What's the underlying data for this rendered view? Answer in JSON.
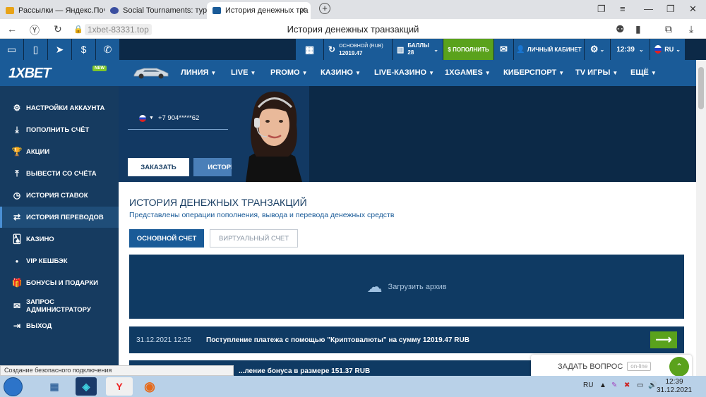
{
  "browser": {
    "tabs": [
      {
        "title": "Рассылки — Яндекс.Почта",
        "active": false
      },
      {
        "title": "Social Tournaments: турни",
        "active": false
      },
      {
        "title": "История денежных тра",
        "active": true
      }
    ],
    "url": "1xbet-83331.top",
    "page_title": "История денежных транзакций"
  },
  "topbar": {
    "balance_label": "ОСНОВНОЙ (RUB)",
    "balance_value": "12019.47",
    "points_label": "БАЛЛЫ",
    "points_value": "28",
    "deposit_label": "$ ПОПОЛНИТЬ",
    "cabinet_label": "ЛИЧНЫЙ КАБИНЕТ",
    "time": "12:39",
    "lang": "RU"
  },
  "nav": {
    "logo": "1XBET",
    "new_badge": "NEW",
    "items": [
      "ЛИНИЯ",
      "LIVE",
      "PROMO",
      "КАЗИНО",
      "LIVE-КАЗИНО",
      "1XGAMES",
      "КИБЕРСПОРТ",
      "TV ИГРЫ",
      "ЕЩЁ"
    ]
  },
  "sidebar": {
    "items": [
      {
        "label": "НАСТРОЙКИ АККАУНТА",
        "icon": "gears-icon"
      },
      {
        "label": "ПОПОЛНИТЬ СЧЁТ",
        "icon": "download-icon"
      },
      {
        "label": "АКЦИИ",
        "icon": "trophy-icon"
      },
      {
        "label": "ВЫВЕСТИ СО СЧЁТА",
        "icon": "upload-icon"
      },
      {
        "label": "ИСТОРИЯ СТАВОК",
        "icon": "clock-icon"
      },
      {
        "label": "ИСТОРИЯ ПЕРЕВОДОВ",
        "icon": "transfer-icon"
      },
      {
        "label": "КАЗИНО",
        "icon": "cards-icon"
      },
      {
        "label": "VIP КЕШБЭК",
        "icon": "dot-icon"
      },
      {
        "label": "БОНУСЫ И ПОДАРКИ",
        "icon": "gift-icon"
      },
      {
        "label": "ЗАПРОС АДМИНИСТРАТОРУ",
        "icon": "mail-icon"
      },
      {
        "label": "ВЫХОД",
        "icon": "exit-icon"
      }
    ]
  },
  "hero": {
    "phone": "+7  904*****62",
    "order_btn": "ЗАКАЗАТЬ",
    "history_btn": "ИСТОРИЯ"
  },
  "panel": {
    "title": "ИСТОРИЯ ДЕНЕЖНЫХ ТРАНЗАКЦИЙ",
    "subtitle": "Представлены операции пополнения, вывода и перевода денежных средств",
    "main_account": "ОСНОВНОЙ СЧЕТ",
    "virtual_account": "ВИРТУАЛЬНЫЙ СЧЕТ",
    "archive": "Загрузить архив",
    "transactions": [
      {
        "date": "31.12.2021 12:25",
        "text": "Поступление платежа с помощью \"Криптовалюты\" на сумму 12019.47 RUB"
      },
      {
        "date": "",
        "text": "...ление бонуса в размере 151.37 RUB"
      }
    ]
  },
  "ask": {
    "label": "ЗАДАТЬ ВОПРОС",
    "status": "on-line"
  },
  "status_bar": "Создание безопасного подключения",
  "taskbar": {
    "lang": "RU",
    "time": "12:39",
    "date": "31.12.2021"
  }
}
